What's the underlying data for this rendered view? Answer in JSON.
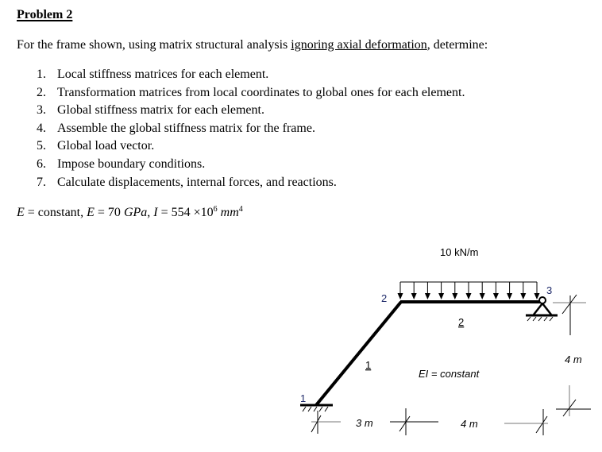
{
  "title": "Problem 2",
  "intro": {
    "before": "For the frame shown, using matrix structural analysis ",
    "underlined": "ignoring axial deformation",
    "after": ", determine:"
  },
  "tasks": [
    {
      "num": "1.",
      "text": "Local stiffness matrices for each element."
    },
    {
      "num": "2.",
      "text": "Transformation matrices from local coordinates to global ones for each element."
    },
    {
      "num": "3.",
      "text": "Global stiffness matrix for each element."
    },
    {
      "num": "4.",
      "text": "Assemble the global stiffness matrix for the frame."
    },
    {
      "num": "5.",
      "text": "Global load vector."
    },
    {
      "num": "6.",
      "text": "Impose boundary conditions."
    },
    {
      "num": "7.",
      "text": "Calculate displacements, internal forces, and reactions."
    }
  ],
  "parameters": {
    "e_sym": "E",
    "e_desc": " = constant, ",
    "e_val_sym": "E",
    "e_val": " = 70 ",
    "e_unit": "GPa",
    "sep": ", ",
    "i_sym": "I",
    "i_val": " = 554 ×10",
    "i_exp": "6",
    "i_unit": " mm",
    "i_unit_exp": "4"
  },
  "diagram": {
    "load_label": "10 kN/m",
    "ei_label": "EI = constant",
    "nodes": {
      "n1": "1",
      "n2": "2",
      "n3": "3"
    },
    "elements": {
      "e1": "1",
      "e2": "2"
    },
    "dims": {
      "horizontal_1": "3 m",
      "horizontal_2": "4 m",
      "vertical": "4 m"
    },
    "supports": {
      "node1": "fixed",
      "node3": "pin"
    }
  }
}
